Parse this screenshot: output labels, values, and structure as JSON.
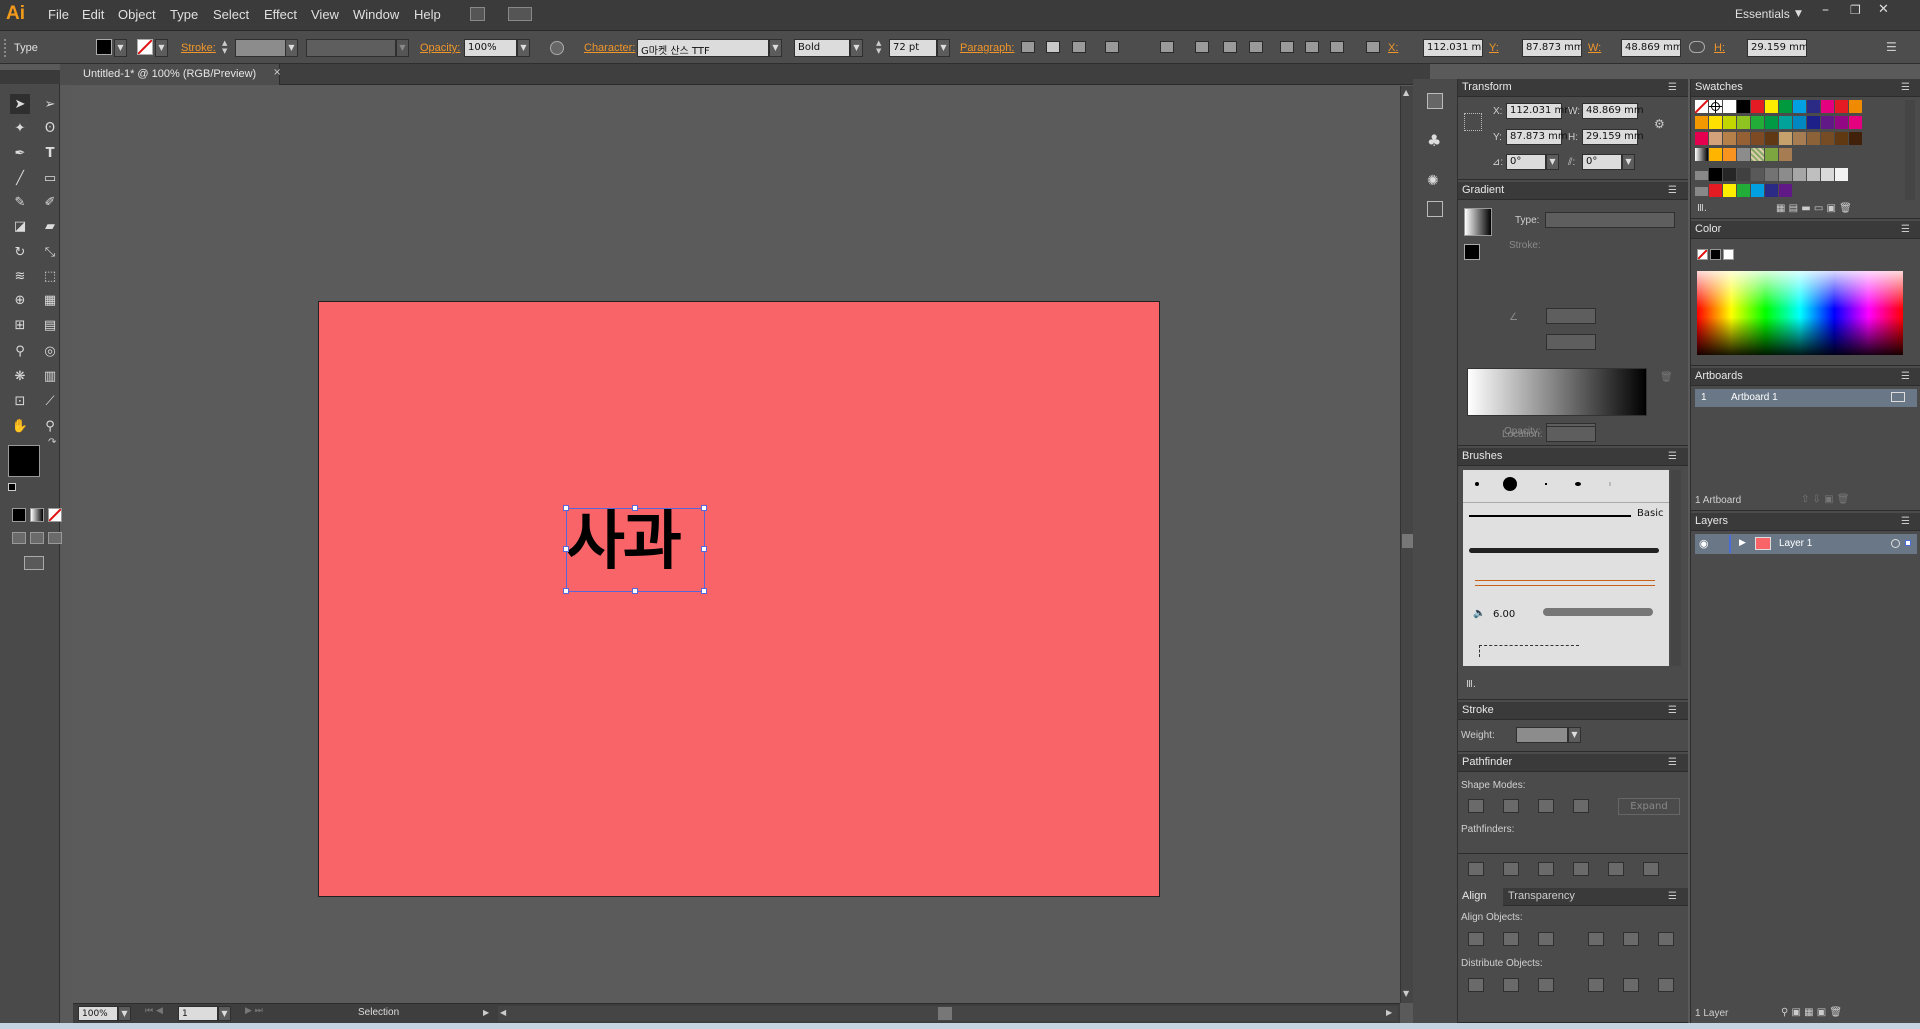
{
  "app": {
    "logo": "Ai",
    "workspace": "Essentials",
    "accent": "#f29a1b"
  },
  "menu": [
    "File",
    "Edit",
    "Object",
    "Type",
    "Select",
    "Effect",
    "View",
    "Window",
    "Help"
  ],
  "control": {
    "tool_label": "Type",
    "stroke_label": "Stroke:",
    "opacity_label": "Opacity:",
    "opacity_value": "100%",
    "character_label": "Character:",
    "font_family": "G마켓 산스 TTF",
    "font_style": "Bold",
    "font_size": "72 pt",
    "paragraph_label": "Paragraph:",
    "x_label": "X:",
    "x_value": "112.031 mm",
    "y_label": "Y:",
    "y_value": "87.873 mm",
    "w_label": "W:",
    "w_value": "48.869 mm",
    "h_label": "H:",
    "h_value": "29.159 mm"
  },
  "document": {
    "tab_title": "Untitled-1* @ 100% (RGB/Preview)",
    "text_object": "사과",
    "artboard_color": "#f86467"
  },
  "status": {
    "zoom": "100%",
    "artboard_num": "1",
    "tool": "Selection"
  },
  "panels": {
    "transform": {
      "title": "Transform",
      "x_label": "X:",
      "x": "112.031 mm",
      "y_label": "Y:",
      "y": "87.873 mm",
      "w_label": "W:",
      "w": "48.869 mm",
      "h_label": "H:",
      "h": "29.159 mm",
      "rotate": "0°",
      "shear": "0°"
    },
    "gradient": {
      "title": "Gradient",
      "type_label": "Type:",
      "stroke_label": "Stroke:",
      "opacity_label": "Opacity:",
      "location_label": "Location:"
    },
    "brushes": {
      "title": "Brushes",
      "basic_label": "Basic",
      "size_value": "6.00"
    },
    "stroke": {
      "title": "Stroke",
      "weight_label": "Weight:"
    },
    "pathfinder": {
      "title": "Pathfinder",
      "shape_modes_label": "Shape Modes:",
      "expand_label": "Expand",
      "pathfinders_label": "Pathfinders:"
    },
    "align": {
      "title": "Align",
      "tab2": "Transparency",
      "align_objects_label": "Align Objects:",
      "distribute_objects_label": "Distribute Objects:"
    },
    "swatches": {
      "title": "Swatches"
    },
    "color": {
      "title": "Color"
    },
    "artboards": {
      "title": "Artboards",
      "row_num": "1",
      "row_name": "Artboard 1",
      "count": "1 Artboard"
    },
    "layers": {
      "title": "Layers",
      "layer_name": "Layer 1",
      "count": "1 Layer"
    }
  }
}
